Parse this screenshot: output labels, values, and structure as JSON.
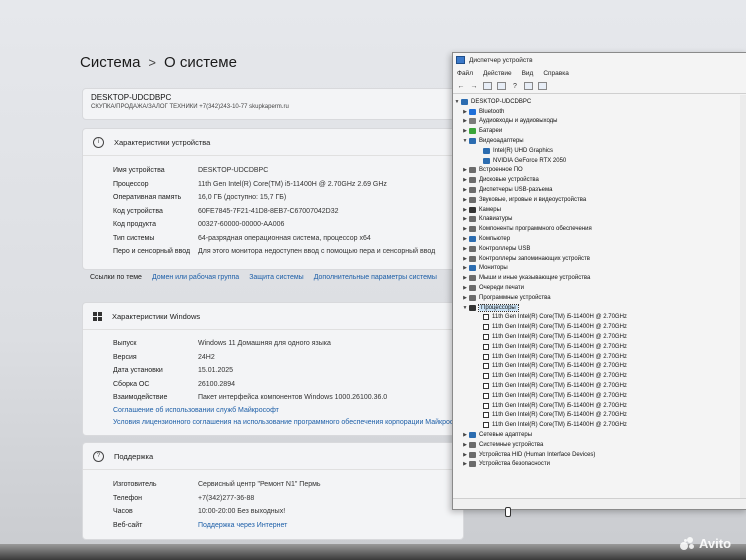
{
  "settings": {
    "breadcrumb": {
      "parent": "Система",
      "separator": ">",
      "current": "О системе"
    },
    "device_card": {
      "name": "DESKTOP-UDCDBPC",
      "subtitle": "СКУПКА/ПРОДАЖА/ЗАЛОГ ТЕХНИКИ +7(342)243-10-77 skupkaperm.ru"
    },
    "device_specs": {
      "header": "Характеристики устройства",
      "rows": [
        {
          "k": "Имя устройства",
          "v": "DESKTOP-UDCDBPC"
        },
        {
          "k": "Процессор",
          "v": "11th Gen Intel(R) Core(TM) i5-11400H @ 2.70GHz   2.69 GHz"
        },
        {
          "k": "Оперативная память",
          "v": "16,0 ГБ (доступно: 15,7 ГБ)"
        },
        {
          "k": "Код устройства",
          "v": "60FE7845-7F21-41D8-8EB7-C67007042D32"
        },
        {
          "k": "Код продукта",
          "v": "00327-60000-00000-AA006"
        },
        {
          "k": "Тип системы",
          "v": "64-разрядная операционная система, процессор x64"
        },
        {
          "k": "Перо и сенсорный ввод",
          "v": "Для этого монитора недоступен ввод с помощью пера и сенсорный ввод"
        }
      ]
    },
    "related_links": {
      "label": "Ссылки по теме",
      "items": [
        "Домен или рабочая группа",
        "Защита системы",
        "Дополнительные параметры системы"
      ]
    },
    "windows_specs": {
      "header": "Характеристики Windows",
      "rows": [
        {
          "k": "Выпуск",
          "v": "Windows 11 Домашняя для одного языка"
        },
        {
          "k": "Версия",
          "v": "24H2"
        },
        {
          "k": "Дата установки",
          "v": "15.01.2025"
        },
        {
          "k": "Сборка ОС",
          "v": "26100.2894"
        },
        {
          "k": "Взаимодействие",
          "v": "Пакет интерфейса компонентов Windows 1000.26100.36.0"
        }
      ],
      "links": [
        "Соглашение об использовании служб Майкрософт",
        "Условия лицензионного соглашения на использование программного обеспечения корпорации Майкрософт"
      ]
    },
    "support": {
      "header": "Поддержка",
      "rows": [
        {
          "k": "Изготовитель",
          "v": "Сервисный центр \"Ремонт N1\" Пермь"
        },
        {
          "k": "Телефон",
          "v": "+7(342)277-36-88"
        },
        {
          "k": "Часов",
          "v": "10:00-20:00 Без выходных!"
        },
        {
          "k": "Веб-сайт",
          "v": "Поддержка через Интернет"
        }
      ]
    }
  },
  "device_manager": {
    "title": "Диспетчер устройств",
    "menu": [
      "Файл",
      "Действие",
      "Вид",
      "Справка"
    ],
    "root": "DESKTOP-UDCDBPC",
    "categories": [
      {
        "label": "Bluetooth",
        "color": "#1e6fd9"
      },
      {
        "label": "Аудиовходы и аудиовыходы",
        "color": "#7a7a7a"
      },
      {
        "label": "Батареи",
        "color": "#3aa53a"
      },
      {
        "label": "Видеоадаптеры",
        "color": "#2b6cb0",
        "expanded": true,
        "children": [
          "Intel(R) UHD Graphics",
          "NVIDIA GeForce RTX 2050"
        ]
      },
      {
        "label": "Встроенное ПО",
        "color": "#6b6b6b"
      },
      {
        "label": "Дисковые устройства",
        "color": "#6b6b6b"
      },
      {
        "label": "Диспетчеры USB-разъема",
        "color": "#6b6b6b"
      },
      {
        "label": "Звуковые, игровые и видеоустройства",
        "color": "#6b6b6b"
      },
      {
        "label": "Камеры",
        "color": "#333333"
      },
      {
        "label": "Клавиатуры",
        "color": "#6b6b6b"
      },
      {
        "label": "Компоненты программного обеспечения",
        "color": "#6b6b6b"
      },
      {
        "label": "Компьютер",
        "color": "#2b6cb0"
      },
      {
        "label": "Контроллеры USB",
        "color": "#6b6b6b"
      },
      {
        "label": "Контроллеры запоминающих устройств",
        "color": "#6b6b6b"
      },
      {
        "label": "Мониторы",
        "color": "#2b6cb0"
      },
      {
        "label": "Мыши и иные указывающие устройства",
        "color": "#6b6b6b"
      },
      {
        "label": "Очереди печати",
        "color": "#6b6b6b"
      },
      {
        "label": "Программные устройства",
        "color": "#6b6b6b"
      },
      {
        "label": "Процессоры",
        "color": "#333333",
        "expanded": true,
        "selected": true,
        "children": [
          "11th Gen Intel(R) Core(TM) i5-11400H @ 2.70GHz",
          "11th Gen Intel(R) Core(TM) i5-11400H @ 2.70GHz",
          "11th Gen Intel(R) Core(TM) i5-11400H @ 2.70GHz",
          "11th Gen Intel(R) Core(TM) i5-11400H @ 2.70GHz",
          "11th Gen Intel(R) Core(TM) i5-11400H @ 2.70GHz",
          "11th Gen Intel(R) Core(TM) i5-11400H @ 2.70GHz",
          "11th Gen Intel(R) Core(TM) i5-11400H @ 2.70GHz",
          "11th Gen Intel(R) Core(TM) i5-11400H @ 2.70GHz",
          "11th Gen Intel(R) Core(TM) i5-11400H @ 2.70GHz",
          "11th Gen Intel(R) Core(TM) i5-11400H @ 2.70GHz",
          "11th Gen Intel(R) Core(TM) i5-11400H @ 2.70GHz",
          "11th Gen Intel(R) Core(TM) i5-11400H @ 2.70GHz"
        ]
      },
      {
        "label": "Сетевые адаптеры",
        "color": "#2b6cb0"
      },
      {
        "label": "Системные устройства",
        "color": "#6b6b6b"
      },
      {
        "label": "Устройства HID (Human Interface Devices)",
        "color": "#6b6b6b"
      },
      {
        "label": "Устройства безопасности",
        "color": "#6b6b6b"
      }
    ]
  },
  "watermark": {
    "text": "Avito"
  }
}
